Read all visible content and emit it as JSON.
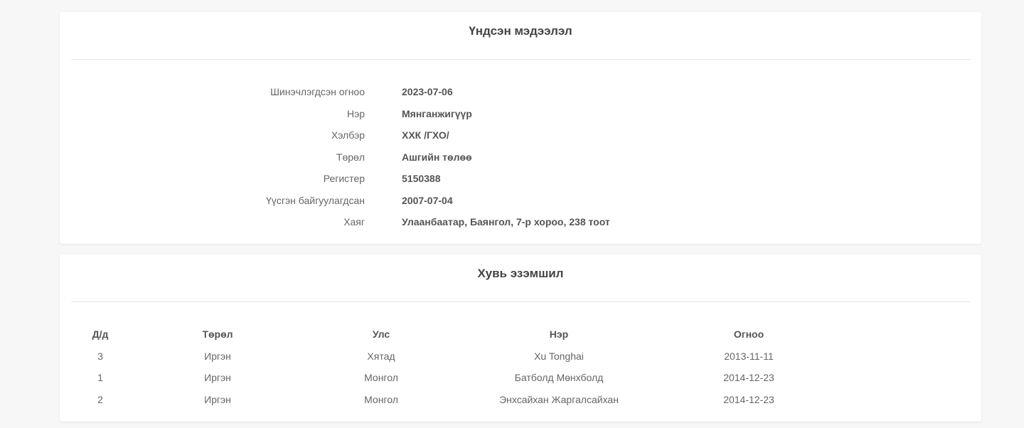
{
  "basic_info": {
    "title": "Үндсэн мэдээлэл",
    "rows": [
      {
        "label": "Шинэчлэгдсэн огноо",
        "value": "2023-07-06"
      },
      {
        "label": "Нэр",
        "value": "Мянганжигүүр"
      },
      {
        "label": "Хэлбэр",
        "value": "ХХК /ГХО/"
      },
      {
        "label": "Төрөл",
        "value": "Ашгийн төлөө"
      },
      {
        "label": "Регистер",
        "value": "5150388"
      },
      {
        "label": "Үүсгэн байгуулагдсан",
        "value": "2007-07-04"
      },
      {
        "label": "Хаяг",
        "value": "Улаанбаатар, Баянгол, 7-р хороо, 238 тоот"
      }
    ]
  },
  "ownership": {
    "title": "Хувь эзэмшил",
    "columns": [
      "Д/д",
      "Төрөл",
      "Улс",
      "Нэр",
      "Огноо"
    ],
    "rows": [
      [
        "3",
        "Иргэн",
        "Хятад",
        "Xu Tonghai",
        "2013-11-11"
      ],
      [
        "1",
        "Иргэн",
        "Монгол",
        "Батболд Мөнхболд",
        "2014-12-23"
      ],
      [
        "2",
        "Иргэн",
        "Монгол",
        "Энхсайхан Жаргалсайхан",
        "2014-12-23"
      ]
    ]
  }
}
